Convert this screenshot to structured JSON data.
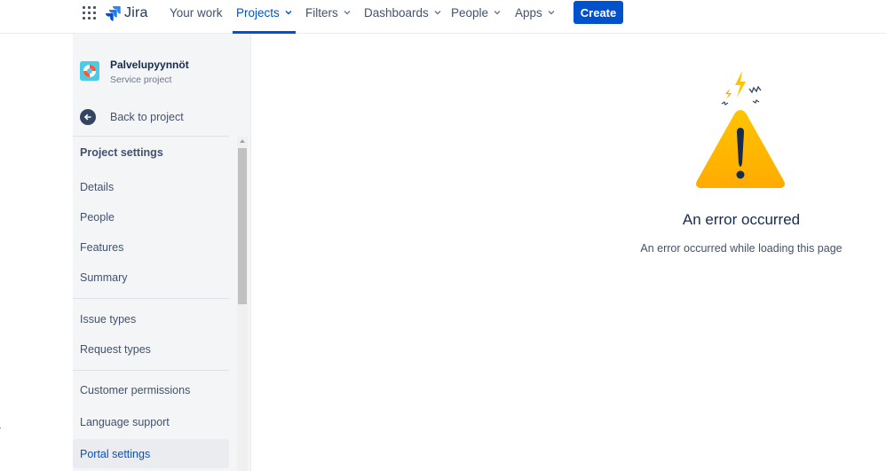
{
  "nav": {
    "product": "Jira",
    "items": [
      {
        "label": "Your work",
        "dropdown": false,
        "active": false
      },
      {
        "label": "Projects",
        "dropdown": true,
        "active": true
      },
      {
        "label": "Filters",
        "dropdown": true,
        "active": false
      },
      {
        "label": "Dashboards",
        "dropdown": true,
        "active": false
      },
      {
        "label": "People",
        "dropdown": true,
        "active": false
      },
      {
        "label": "Apps",
        "dropdown": true,
        "active": false
      }
    ],
    "create_label": "Create",
    "icons": [
      "app-switcher-icon",
      "jira-logo-icon",
      "chevron-down-icon"
    ],
    "accent_color": "#0052cc"
  },
  "sidebar": {
    "project_name": "Palvelupyynnöt",
    "project_type": "Service project",
    "back_label": "Back to project",
    "settings_heading": "Project settings",
    "group1": [
      "Details",
      "People",
      "Features",
      "Summary"
    ],
    "group2": [
      "Issue types",
      "Request types"
    ],
    "group3": [
      "Customer permissions",
      "Language support",
      "Portal settings"
    ],
    "selected_item": "Portal settings"
  },
  "main": {
    "error_title": "An error occurred",
    "error_message": "An error occurred while loading this page",
    "illustration": "warning-triangle-icon",
    "warning_color": "#ffab00"
  }
}
